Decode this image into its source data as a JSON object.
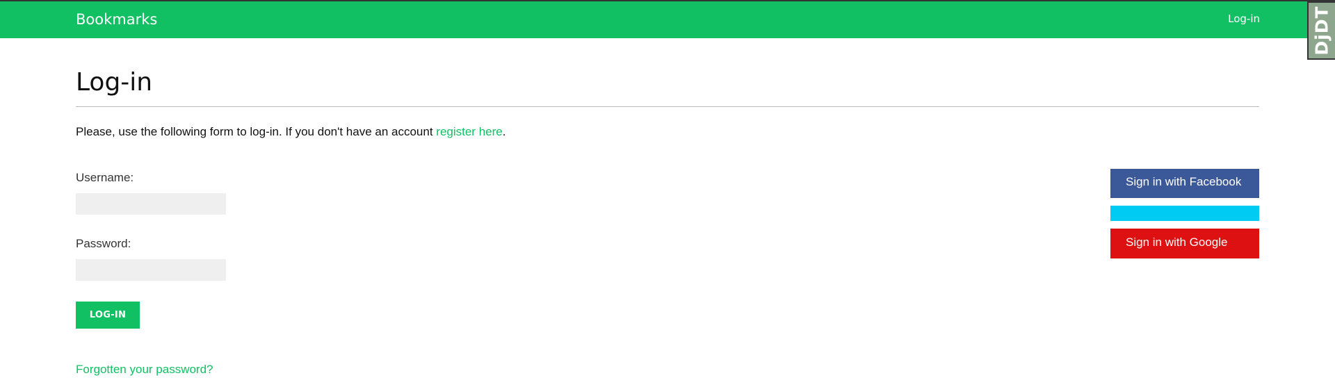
{
  "header": {
    "logo": "Bookmarks",
    "login_link": "Log-in"
  },
  "debug_toolbar": {
    "handle_label": "DjDT"
  },
  "main": {
    "title": "Log-in",
    "intro_text": "Please, use the following form to log-in. If you don't have an account ",
    "register_link": "register here",
    "intro_suffix": "."
  },
  "form": {
    "username_label": "Username:",
    "username_value": "",
    "password_label": "Password:",
    "password_value": "",
    "submit_label": "LOG-IN",
    "forgot_link": "Forgotten your password?"
  },
  "social": {
    "facebook_label": "Sign in with Facebook",
    "twitter_label": "",
    "google_label": "Sign in with Google"
  },
  "colors": {
    "brand_green": "#12c064",
    "facebook_blue": "#3b5998",
    "twitter_cyan": "#00ccf3",
    "google_red": "#dd1111"
  }
}
